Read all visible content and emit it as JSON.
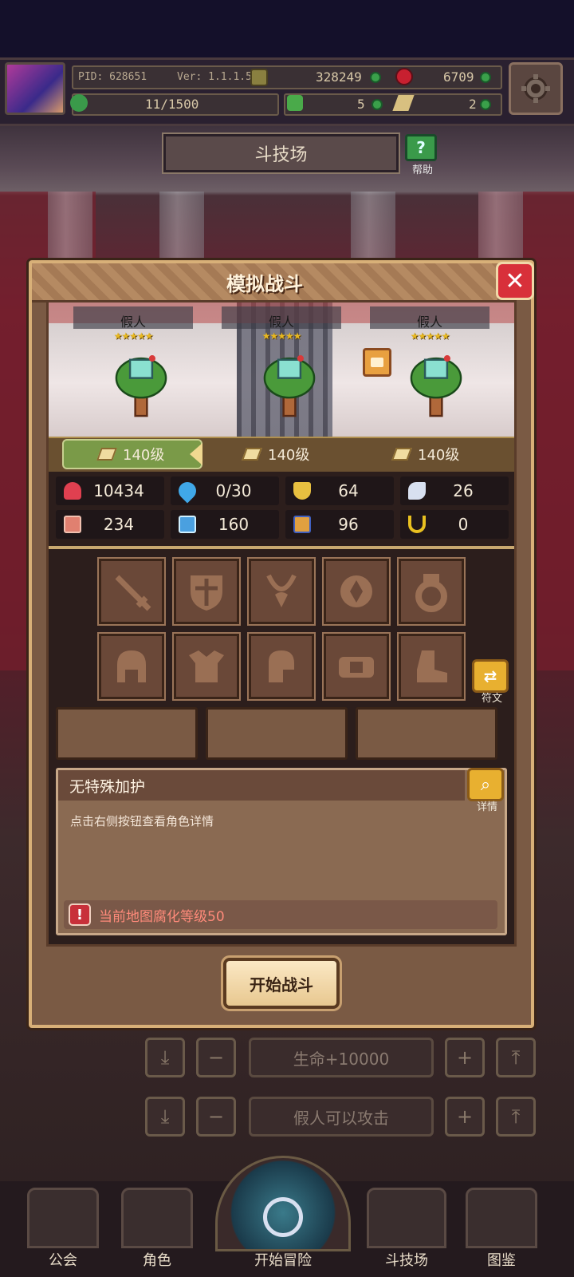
{
  "top_bar": {
    "pid": "PID: 628651",
    "version": "Ver: 1.1.1.5",
    "gold": "328249",
    "gems": "6709",
    "stamina": "11/1500",
    "clover": "5",
    "tickets": "2"
  },
  "arena": {
    "title": "斗技场",
    "help_label": "帮助"
  },
  "modal": {
    "title": "模拟战斗",
    "close_icon": "close-icon",
    "dummies": [
      {
        "name": "假人",
        "stars": "★★★★★",
        "level": "140级"
      },
      {
        "name": "假人",
        "stars": "★★★★★",
        "level": "140级"
      },
      {
        "name": "假人",
        "stars": "★★★★★",
        "level": "140级"
      }
    ],
    "stats": [
      {
        "icon": "heart-icon",
        "value": "10434",
        "color": "#e04050"
      },
      {
        "icon": "water-drop-icon",
        "value": "0/30",
        "color": "#40a8e8"
      },
      {
        "icon": "shield-icon",
        "value": "64",
        "color": "#e8c040"
      },
      {
        "icon": "wing-icon",
        "value": "26",
        "color": "#d8e0f0"
      },
      {
        "icon": "fist-icon",
        "value": "234",
        "color": "#e08070"
      },
      {
        "icon": "book-icon",
        "value": "160",
        "color": "#4aa0e0"
      },
      {
        "icon": "boot-icon",
        "value": "96",
        "color": "#e0a040"
      },
      {
        "icon": "horseshoe-icon",
        "value": "0",
        "color": "#e8c020"
      }
    ],
    "equipment_slots": [
      "sword-icon",
      "shield-slot-icon",
      "necklace-icon",
      "amulet-icon",
      "ring-icon",
      "helmet-icon",
      "armor-icon",
      "gloves-icon",
      "belt-icon",
      "boots-icon"
    ],
    "rune_label": "符文",
    "info": {
      "title": "无特殊加护",
      "description": "点击右侧按钮查看角色详情",
      "detail_label": "详情",
      "warning": "当前地图腐化等级50"
    },
    "start_button": "开始战斗"
  },
  "controls": {
    "row1_label": "生命+10000",
    "row2_label": "假人可以攻击"
  },
  "bottom_nav": {
    "guild": "公会",
    "character": "角色",
    "adventure": "开始冒险",
    "arena": "斗技场",
    "codex": "图鉴"
  }
}
